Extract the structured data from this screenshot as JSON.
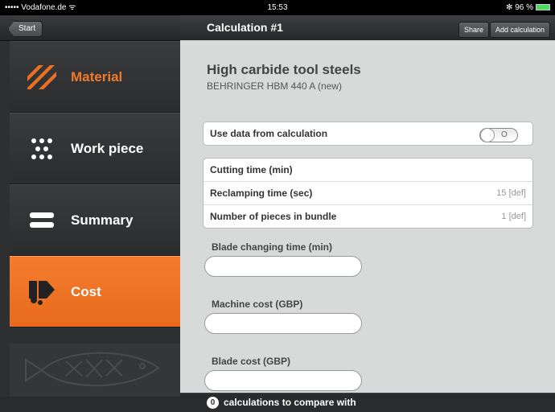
{
  "status_bar": {
    "carrier": "••••• Vodafone.de ᯤ",
    "time": "15:53",
    "battery": "✻ 96 %"
  },
  "left_nav": {
    "back_label": "Start"
  },
  "menu": [
    {
      "label": "Material",
      "icon": "material-stripes-icon",
      "active": false
    },
    {
      "label": "Work piece",
      "icon": "work-piece-dots-icon",
      "active": false
    },
    {
      "label": "Summary",
      "icon": "summary-bars-icon",
      "active": false
    },
    {
      "label": "Cost",
      "icon": "cost-icon",
      "active": true
    }
  ],
  "header": {
    "title": "Calculation #1",
    "share_label": "Share",
    "add_label": "Add calculation"
  },
  "material": {
    "name": "High carbide tool steels",
    "blade": "BEHRINGER HBM 440 A (new)"
  },
  "use_data": {
    "label": "Use data from calculation",
    "toggle_text": "O",
    "on": false
  },
  "params": [
    {
      "label": "Cutting time (min)",
      "value": ""
    },
    {
      "label": "Reclamping time (sec)",
      "value": "15  [def]"
    },
    {
      "label": "Number of pieces in bundle",
      "value": "1  [def]"
    }
  ],
  "fields": [
    {
      "label": "Blade changing time (min)",
      "value": ""
    },
    {
      "label": "Machine cost (GBP)",
      "value": ""
    },
    {
      "label": "Blade cost (GBP)",
      "value": ""
    }
  ],
  "footer": {
    "count": "0",
    "text": "calculations to compare with"
  },
  "colors": {
    "accent": "#ec6f22",
    "background": "#2b2c2e"
  }
}
